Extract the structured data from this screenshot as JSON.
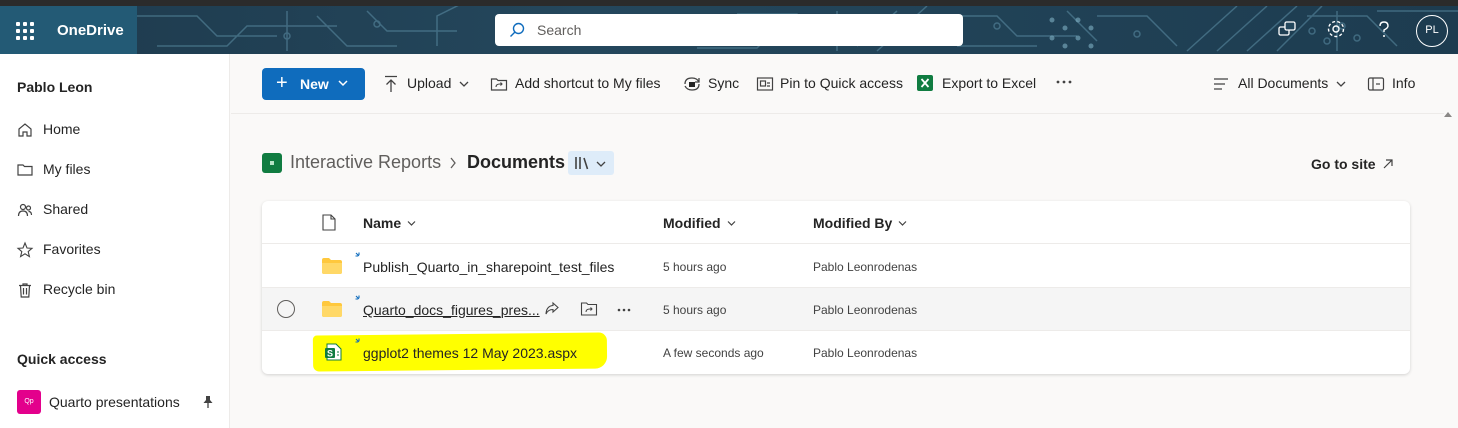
{
  "app": {
    "name": "OneDrive"
  },
  "search": {
    "placeholder": "Search"
  },
  "user": {
    "name": "Pablo Leon",
    "initials": "PL"
  },
  "nav": {
    "items": [
      {
        "label": "Home",
        "icon": "home-icon"
      },
      {
        "label": "My files",
        "icon": "folder-icon"
      },
      {
        "label": "Shared",
        "icon": "people-icon"
      },
      {
        "label": "Favorites",
        "icon": "star-icon"
      },
      {
        "label": "Recycle bin",
        "icon": "trash-icon"
      }
    ]
  },
  "quick_access": {
    "title": "Quick access",
    "items": [
      {
        "label": "Quarto presentations",
        "badge": "Qp",
        "badge_color": "#e3008c"
      }
    ]
  },
  "toolbar": {
    "new_label": "New",
    "upload_label": "Upload",
    "shortcut_label": "Add shortcut to My files",
    "sync_label": "Sync",
    "pin_label": "Pin to Quick access",
    "export_label": "Export to Excel",
    "view_label": "All Documents",
    "info_label": "Info"
  },
  "breadcrumb": {
    "site": "Interactive Reports",
    "current": "Documents"
  },
  "go_to_site": "Go to site",
  "columns": {
    "name": "Name",
    "modified": "Modified",
    "modified_by": "Modified By"
  },
  "files": [
    {
      "name": "Publish_Quarto_in_sharepoint_test_files",
      "type": "folder",
      "modified": "5 hours ago",
      "modified_by": "Pablo Leonrodenas"
    },
    {
      "name": "Quarto_docs_figures_pres...",
      "type": "folder",
      "modified": "5 hours ago",
      "modified_by": "Pablo Leonrodenas"
    },
    {
      "name": "ggplot2 themes 12 May 2023.aspx",
      "type": "sharepoint-page",
      "modified": "A few seconds ago",
      "modified_by": "Pablo Leonrodenas",
      "highlighted": true
    }
  ],
  "colors": {
    "accent": "#0f6cbd",
    "topbar": "#1e3a4d",
    "folder": "#ffc83d",
    "excel": "#107c41",
    "highlight": "#ffff00"
  }
}
